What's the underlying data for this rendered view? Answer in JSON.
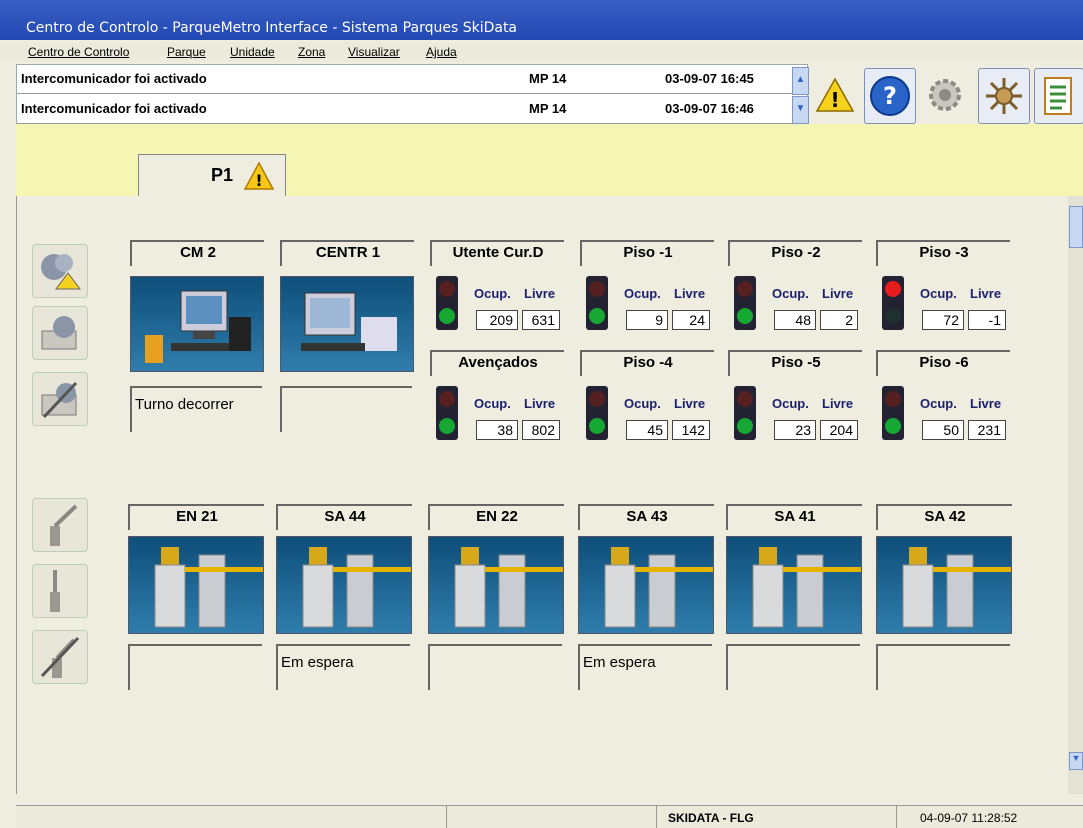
{
  "window": {
    "title": "Centro de Controlo - ParqueMetro Interface - Sistema Parques SkiData"
  },
  "menu": [
    "Centro de Controlo",
    "Parque",
    "Unidade",
    "Zona",
    "Visualizar",
    "Ajuda"
  ],
  "alarms": [
    {
      "message": "Intercomunicador foi activado",
      "unit": "MP 14",
      "time": "03-09-07 16:45"
    },
    {
      "message": "Intercomunicador foi activado",
      "unit": "MP 14",
      "time": "03-09-07 16:46"
    }
  ],
  "toolbar": {
    "icons": [
      "warning-icon",
      "help-icon",
      "settings-icon",
      "control-icon",
      "report-icon"
    ],
    "help_symbol": "?",
    "warn_symbol": "!"
  },
  "tab": {
    "label": "P1"
  },
  "units": [
    {
      "name": "CM 2",
      "status": "Turno decorrer"
    },
    {
      "name": "CENTR 1",
      "status": ""
    }
  ],
  "counters_label": {
    "occupied": "Ocup.",
    "free": "Livre"
  },
  "counters": [
    {
      "name": "Utente Cur.D",
      "occupied": "209",
      "free": "631",
      "light": "green"
    },
    {
      "name": "Piso -1",
      "occupied": "9",
      "free": "24",
      "light": "green"
    },
    {
      "name": "Piso -2",
      "occupied": "48",
      "free": "2",
      "light": "green"
    },
    {
      "name": "Piso -3",
      "occupied": "72",
      "free": "-1",
      "light": "red"
    },
    {
      "name": "Avençados",
      "occupied": "38",
      "free": "802",
      "light": "green"
    },
    {
      "name": "Piso -4",
      "occupied": "45",
      "free": "142",
      "light": "green"
    },
    {
      "name": "Piso -5",
      "occupied": "23",
      "free": "204",
      "light": "green"
    },
    {
      "name": "Piso -6",
      "occupied": "50",
      "free": "231",
      "light": "green"
    }
  ],
  "gates": [
    {
      "name": "EN 21",
      "status": ""
    },
    {
      "name": "SA 44",
      "status": "Em espera"
    },
    {
      "name": "EN 22",
      "status": ""
    },
    {
      "name": "SA 43",
      "status": "Em espera"
    },
    {
      "name": "SA 41",
      "status": ""
    },
    {
      "name": "SA 42",
      "status": ""
    }
  ],
  "statusbar": {
    "system": "SKIDATA - FLG",
    "datetime": "04-09-07 11:28:52"
  }
}
